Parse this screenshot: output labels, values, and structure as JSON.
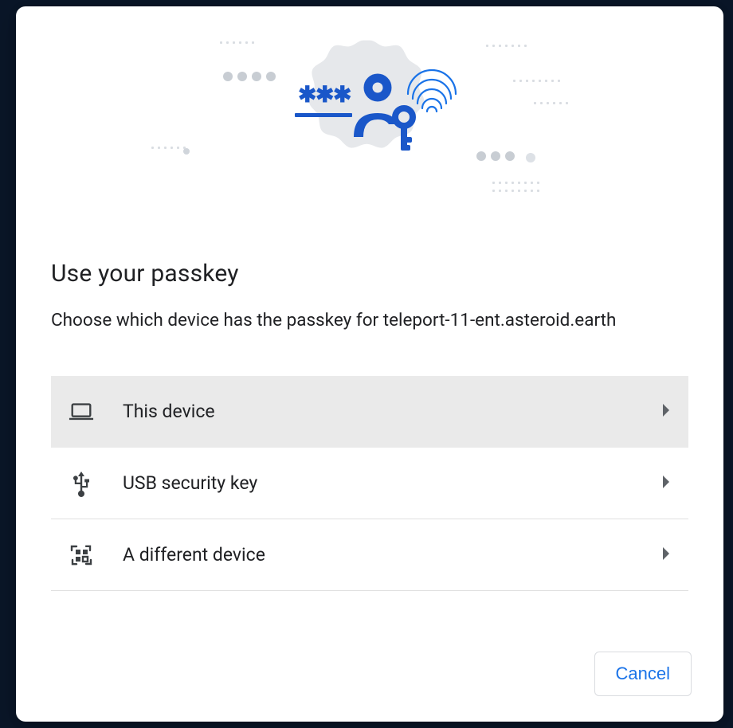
{
  "dialog": {
    "title": "Use your passkey",
    "subtitle": "Choose which device has the passkey for teleport-11-ent.asteroid.earth",
    "options": [
      {
        "id": "this-device",
        "label": "This device",
        "highlighted": true
      },
      {
        "id": "usb-key",
        "label": "USB security key",
        "highlighted": false
      },
      {
        "id": "different-device",
        "label": "A different device",
        "highlighted": false
      }
    ],
    "cancel_label": "Cancel"
  },
  "colors": {
    "accent": "#1a73e8",
    "icon_blue": "#1967d2",
    "text": "#202124",
    "muted": "#5f6368",
    "highlight_row": "#eaeaea"
  }
}
